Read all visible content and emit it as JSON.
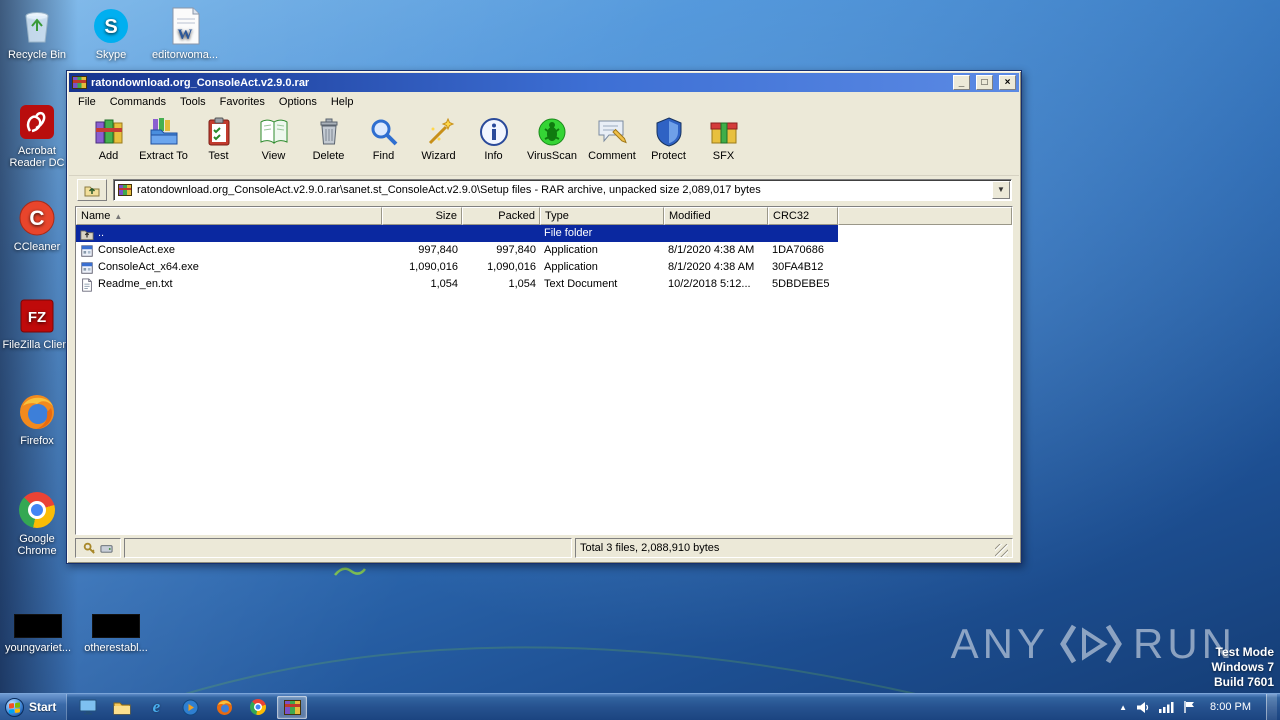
{
  "icons": {
    "sort_asc": "▲",
    "dropdown": "▼",
    "minimize": "_",
    "maximize": "□",
    "close": "×",
    "tray_caret": "▲"
  },
  "desktop": {
    "icons": [
      {
        "label": "Recycle Bin"
      },
      {
        "label": "Skype"
      },
      {
        "label": "editorwoma..."
      },
      {
        "label": "Acrobat Reader DC"
      },
      {
        "label": "CCleaner"
      },
      {
        "label": "FileZilla Client"
      },
      {
        "label": "Firefox"
      },
      {
        "label": "Google Chrome"
      }
    ],
    "thumbnails": [
      {
        "label": "youngvariet..."
      },
      {
        "label": "otherestabl..."
      }
    ],
    "watermark": {
      "left": "ANY",
      "right": "RUN",
      "line1": "Test Mode",
      "line2": "Windows 7",
      "line3": "Build 7601"
    }
  },
  "winrar": {
    "title": "ratondownload.org_ConsoleAct.v2.9.0.rar",
    "menus": [
      "File",
      "Commands",
      "Tools",
      "Favorites",
      "Options",
      "Help"
    ],
    "toolbar": [
      {
        "label": "Add"
      },
      {
        "label": "Extract To"
      },
      {
        "label": "Test"
      },
      {
        "label": "View"
      },
      {
        "label": "Delete"
      },
      {
        "label": "Find"
      },
      {
        "label": "Wizard"
      },
      {
        "label": "Info"
      },
      {
        "label": "VirusScan"
      },
      {
        "label": "Comment"
      },
      {
        "label": "Protect"
      },
      {
        "label": "SFX"
      }
    ],
    "address": "ratondownload.org_ConsoleAct.v2.9.0.rar\\sanet.st_ConsoleAct.v2.9.0\\Setup files - RAR archive, unpacked size 2,089,017 bytes",
    "columns": [
      "Name",
      "Size",
      "Packed",
      "Type",
      "Modified",
      "CRC32"
    ],
    "rows": [
      {
        "name": "..",
        "size": "",
        "packed": "",
        "type": "File folder",
        "modified": "",
        "crc32": ""
      },
      {
        "name": "ConsoleAct.exe",
        "size": "997,840",
        "packed": "997,840",
        "type": "Application",
        "modified": "8/1/2020 4:38 AM",
        "crc32": "1DA70686"
      },
      {
        "name": "ConsoleAct_x64.exe",
        "size": "1,090,016",
        "packed": "1,090,016",
        "type": "Application",
        "modified": "8/1/2020 4:38 AM",
        "crc32": "30FA4B12"
      },
      {
        "name": "Readme_en.txt",
        "size": "1,054",
        "packed": "1,054",
        "type": "Text Document",
        "modified": "10/2/2018 5:12...",
        "crc32": "5DBDEBE5"
      }
    ],
    "status": "Total 3 files, 2,088,910 bytes"
  },
  "taskbar": {
    "start_label": "Start",
    "clock": "8:00 PM"
  }
}
